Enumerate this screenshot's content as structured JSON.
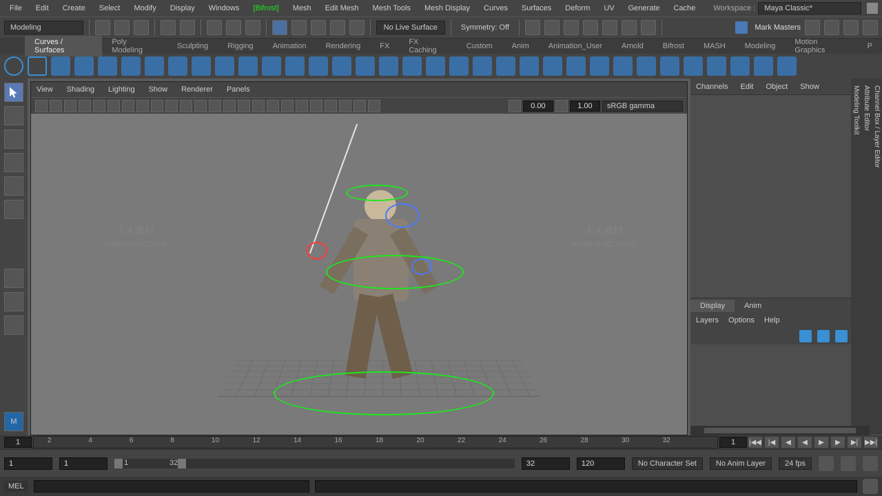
{
  "menubar": {
    "items": [
      "File",
      "Edit",
      "Create",
      "Select",
      "Modify",
      "Display",
      "Windows",
      "[Bifrost]",
      "Mesh",
      "Edit Mesh",
      "Mesh Tools",
      "Mesh Display",
      "Curves",
      "Surfaces",
      "Deform",
      "UV",
      "Generate",
      "Cache"
    ],
    "highlight_index": 7,
    "workspace_label": "Workspace :",
    "workspace_value": "Maya Classic*"
  },
  "statusline": {
    "mode": "Modeling",
    "live_surface": "No Live Surface",
    "symmetry": "Symmetry: Off",
    "user": "Mark Masters"
  },
  "shelf": {
    "tabs": [
      "Curves / Surfaces",
      "Poly Modeling",
      "Sculpting",
      "Rigging",
      "Animation",
      "Rendering",
      "FX",
      "FX Caching",
      "Custom",
      "Anim",
      "Animation_User",
      "Arnold",
      "Bifrost",
      "MASH",
      "Modeling",
      "Motion Graphics",
      "P"
    ],
    "active_index": 0
  },
  "viewport": {
    "menus": [
      "View",
      "Shading",
      "Lighting",
      "Show",
      "Renderer",
      "Panels"
    ],
    "exposure": "0.00",
    "gamma": "1.00",
    "colorspace": "sRGB gamma"
  },
  "channelbox": {
    "head": [
      "Channels",
      "Edit",
      "Object",
      "Show"
    ],
    "tabs": [
      "Display",
      "Anim"
    ],
    "active_tab": 0,
    "options": [
      "Layers",
      "Options",
      "Help"
    ]
  },
  "side_tabs": [
    "Channel Box / Layer Editor",
    "Attribute Editor",
    "Modeling Toolkit"
  ],
  "timeline": {
    "current": "1",
    "ticks": [
      "2",
      "4",
      "6",
      "8",
      "10",
      "12",
      "14",
      "16",
      "18",
      "20",
      "22",
      "24",
      "26",
      "28",
      "30",
      "32"
    ],
    "right_current": "1"
  },
  "range": {
    "start": "1",
    "in": "1",
    "in2": "1",
    "out": "32",
    "out2": "32",
    "end": "120",
    "char_set": "No Character Set",
    "anim_layer": "No Anim Layer",
    "fps": "24 fps"
  },
  "cmdline": {
    "lang": "MEL"
  },
  "watermark": {
    "zh": "人人素材",
    "url": "www.rr-sc.com"
  }
}
